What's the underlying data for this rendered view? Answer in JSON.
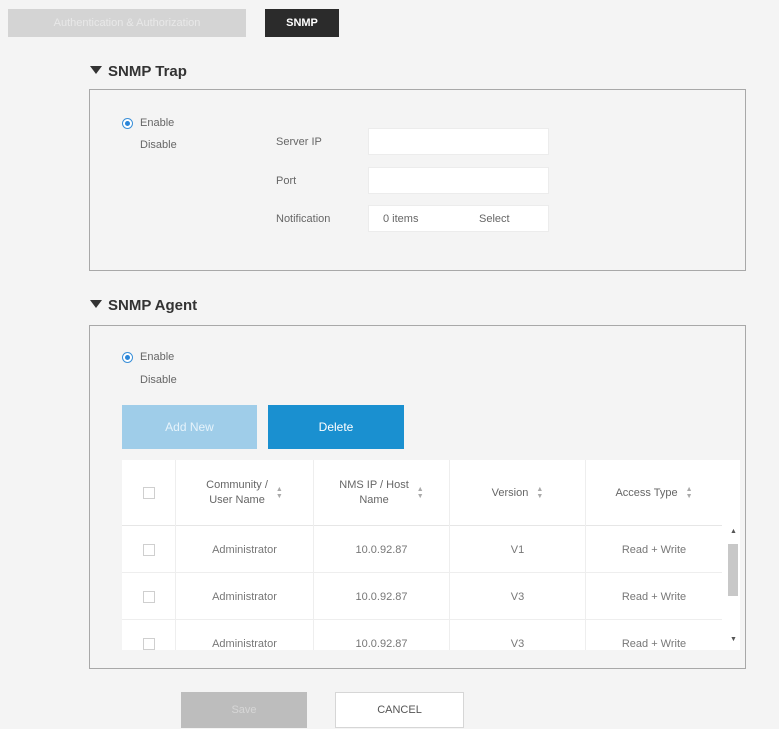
{
  "tabs": [
    {
      "label": "Authentication & Authorization"
    },
    {
      "label": "SNMP"
    }
  ],
  "snmp_trap": {
    "title": "SNMP Trap",
    "enable_label": "Enable",
    "disable_label": "Disable",
    "server_ip_label": "Server IP",
    "server_ip_value": "",
    "port_label": "Port",
    "port_value": "",
    "notification_label": "Notification",
    "notification_items": "0 items",
    "notification_select": "Select"
  },
  "snmp_agent": {
    "title": "SNMP Agent",
    "enable_label": "Enable",
    "disable_label": "Disable",
    "add_new_label": "Add New",
    "delete_label": "Delete",
    "columns": [
      "Community / User Name",
      "NMS IP / Host Name",
      "Version",
      "Access Type"
    ],
    "column_lines": [
      [
        "Community /",
        "User Name"
      ],
      [
        "NMS IP / Host",
        "Name"
      ],
      [
        "Version"
      ],
      [
        "Access Type"
      ]
    ],
    "rows": [
      {
        "user": "Administrator",
        "ip": "10.0.92.87",
        "version": "V1",
        "access": "Read + Write"
      },
      {
        "user": "Administrator",
        "ip": "10.0.92.87",
        "version": "V3",
        "access": "Read + Write"
      },
      {
        "user": "Administrator",
        "ip": "10.0.92.87",
        "version": "V3",
        "access": "Read + Write"
      }
    ]
  },
  "footer": {
    "save_label": "Save",
    "cancel_label": "CANCEL"
  },
  "colors": {
    "primary_button": "#1a90d0",
    "disabled_button": "#9fcde9",
    "active_tab": "#2b2b2b"
  }
}
